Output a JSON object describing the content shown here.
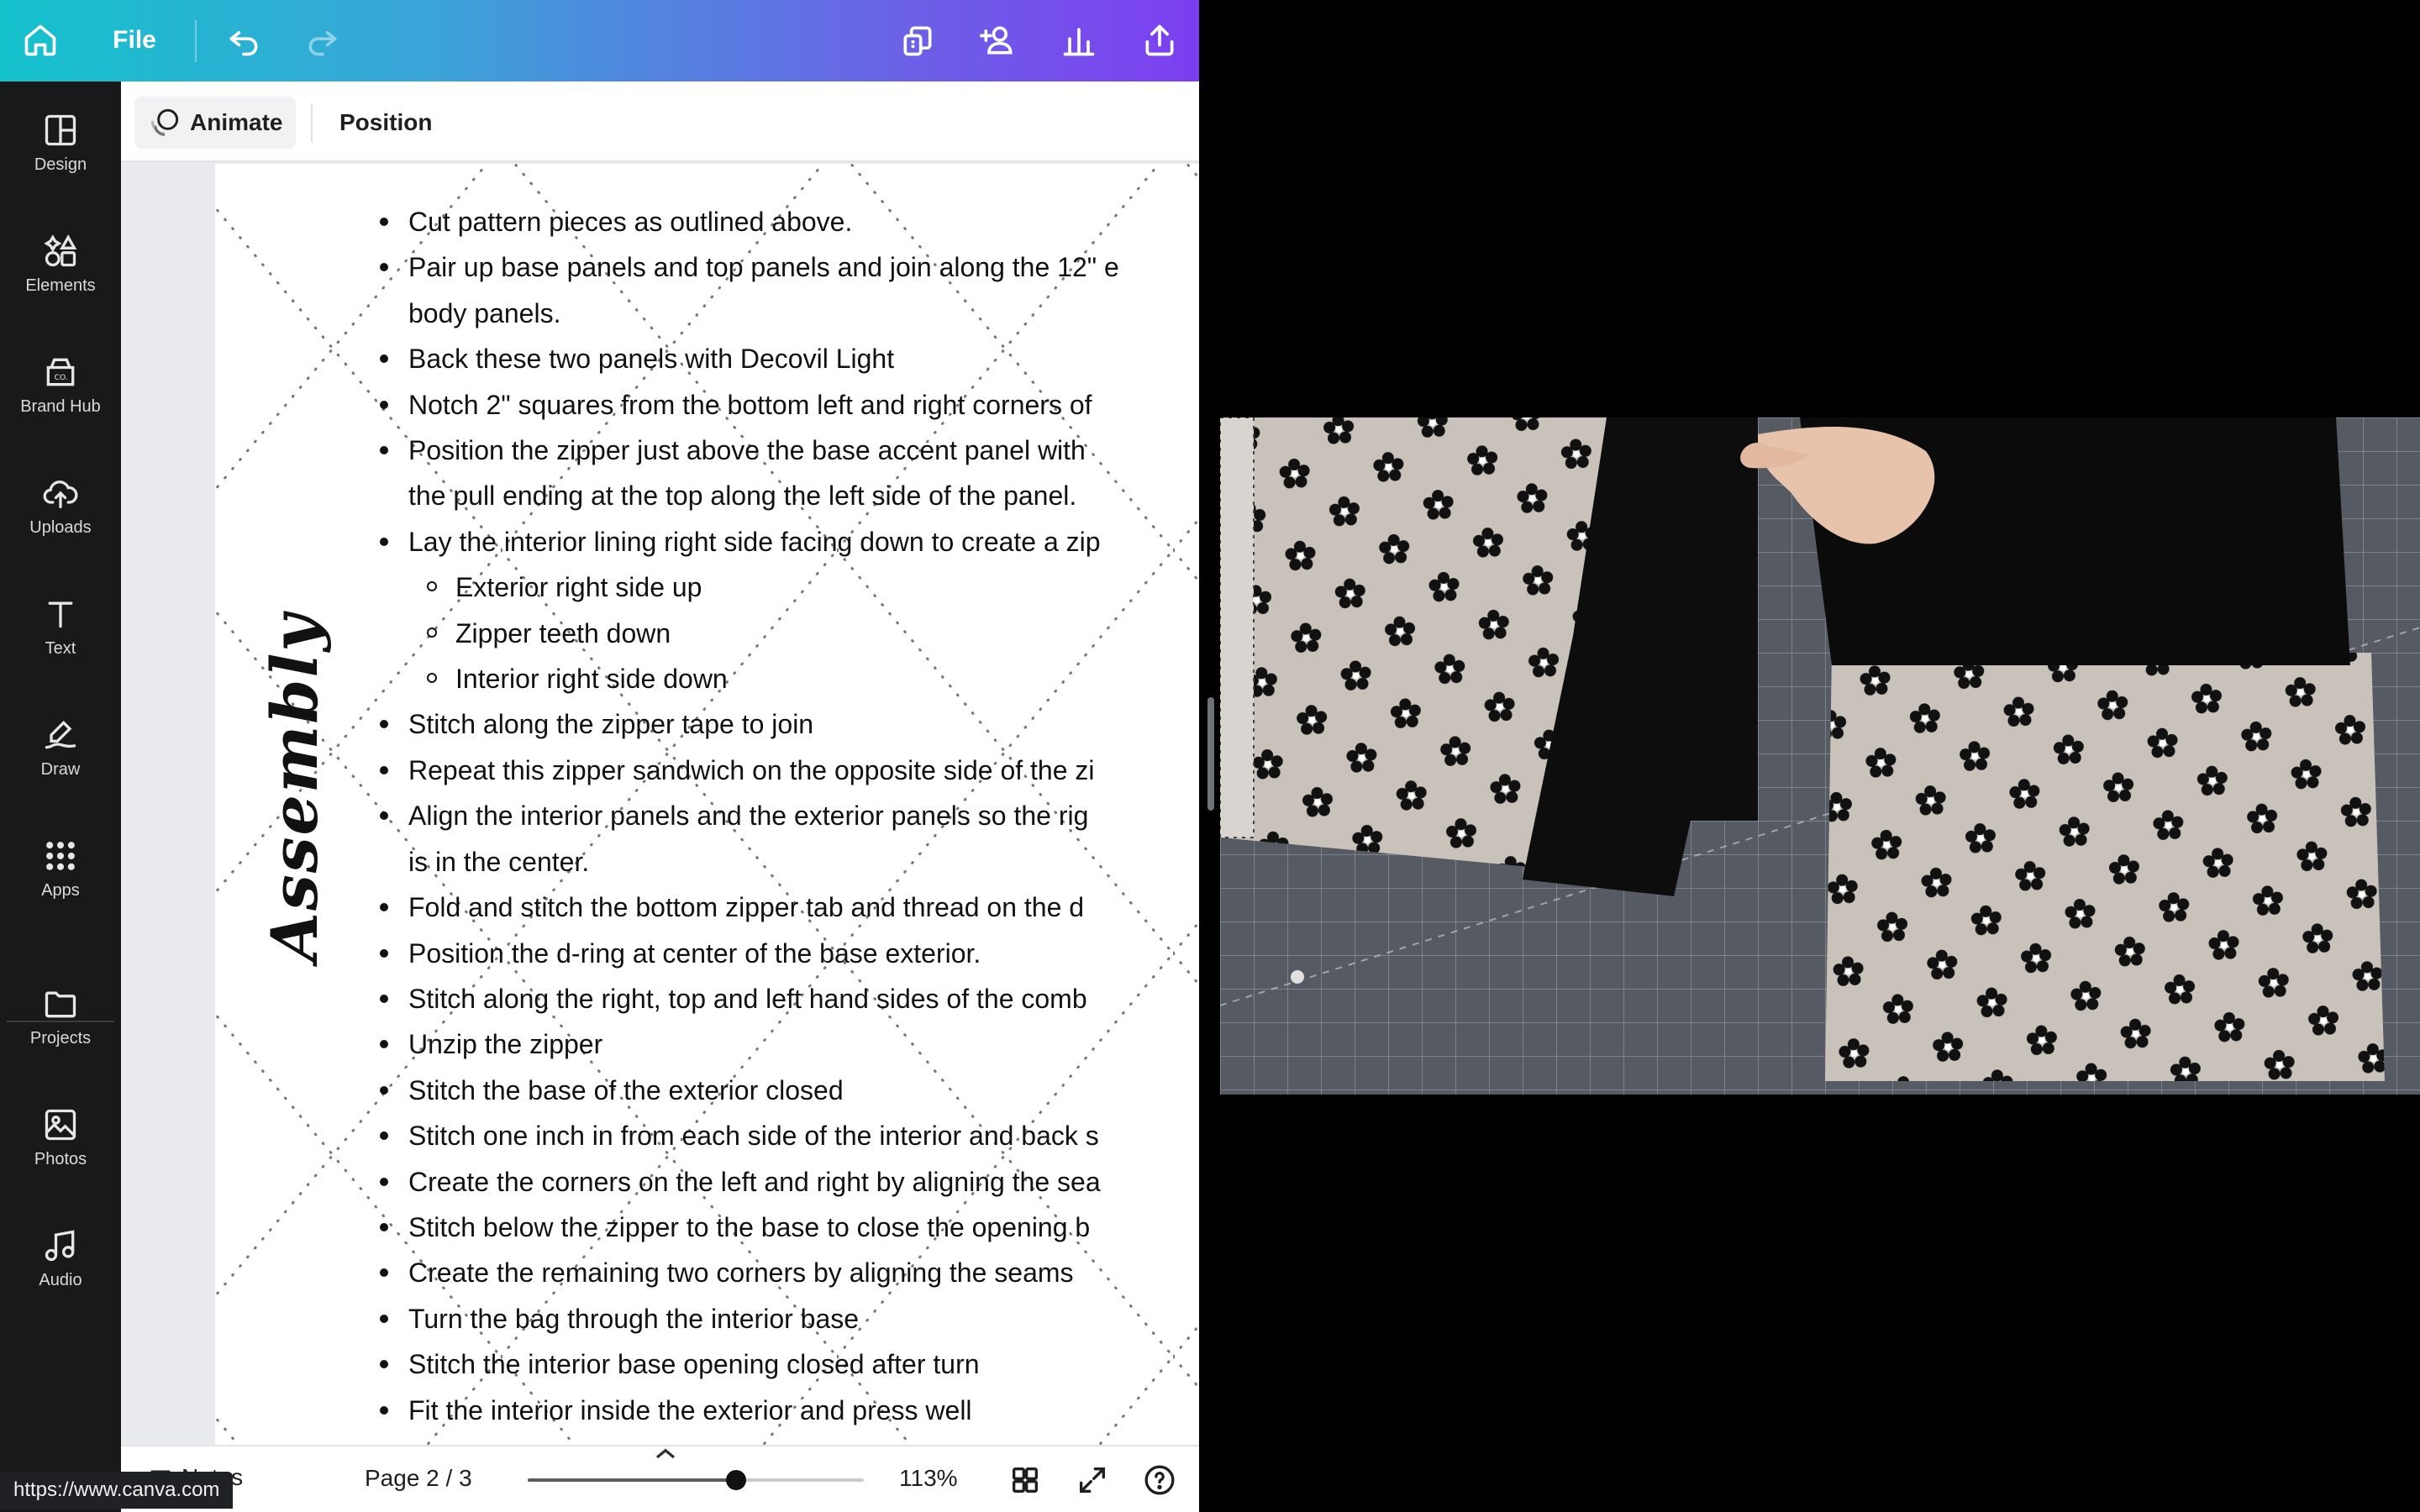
{
  "topbar": {
    "file_label": "File",
    "icons": [
      "home-icon",
      "undo-icon",
      "redo-icon",
      "resize-icon",
      "share-people-icon",
      "insights-icon",
      "upload-share-icon"
    ]
  },
  "sidebar": {
    "items": [
      {
        "label": "Design",
        "icon": "design-icon"
      },
      {
        "label": "Elements",
        "icon": "elements-icon"
      },
      {
        "label": "Brand Hub",
        "icon": "brand-hub-icon"
      },
      {
        "label": "Uploads",
        "icon": "uploads-icon"
      },
      {
        "label": "Text",
        "icon": "text-icon"
      },
      {
        "label": "Draw",
        "icon": "draw-icon"
      },
      {
        "label": "Apps",
        "icon": "apps-icon"
      },
      {
        "label": "Projects",
        "icon": "projects-icon"
      },
      {
        "label": "Photos",
        "icon": "photos-icon"
      },
      {
        "label": "Audio",
        "icon": "audio-icon"
      }
    ]
  },
  "context_toolbar": {
    "animate_label": "Animate",
    "position_label": "Position"
  },
  "document": {
    "section_title": "Assembly",
    "list": [
      {
        "level": 1,
        "text": "Cut pattern pieces as outlined above."
      },
      {
        "level": 1,
        "text": "Pair up base panels and top panels and join along the 12\" e"
      },
      {
        "level": 0,
        "text": "body panels."
      },
      {
        "level": 1,
        "text": "Back these two panels with Decovil Light"
      },
      {
        "level": 1,
        "text": "Notch 2\" squares from the bottom left and right corners of"
      },
      {
        "level": 1,
        "text": "Position the zipper just above the base accent panel with"
      },
      {
        "level": 0,
        "text": "the pull ending at the top along the left side of the panel."
      },
      {
        "level": 1,
        "text": "Lay the interior lining right side facing down to create a zip"
      },
      {
        "level": 2,
        "text": "Exterior right side up"
      },
      {
        "level": 2,
        "text": "Zipper teeth down"
      },
      {
        "level": 2,
        "text": "Interior right side down"
      },
      {
        "level": 1,
        "text": "Stitch along the zipper tape to join"
      },
      {
        "level": 1,
        "text": "Repeat this zipper sandwich on the opposite side of the zi"
      },
      {
        "level": 1,
        "text": " Align the interior panels and the exterior panels so the rig"
      },
      {
        "level": 0,
        "text": "is in the center."
      },
      {
        "level": 1,
        "text": "Fold and stitch the bottom zipper tab and thread on the d"
      },
      {
        "level": 1,
        "text": "Position the d-ring at center of the base exterior."
      },
      {
        "level": 1,
        "text": "Stitch along the right, top and left hand sides of the comb"
      },
      {
        "level": 1,
        "text": "Unzip the zipper"
      },
      {
        "level": 1,
        "text": "Stitch the base of the exterior closed"
      },
      {
        "level": 1,
        "text": "Stitch one inch in from each side of the interior and back s"
      },
      {
        "level": 1,
        "text": "Create the corners on the left and right by aligning the sea"
      },
      {
        "level": 1,
        "text": "Stitch below the zipper to the base to close the opening b"
      },
      {
        "level": 1,
        "text": "Create the remaining two corners by aligning the seams"
      },
      {
        "level": 1,
        "text": "Turn the bag through the interior base"
      },
      {
        "level": 1,
        "text": "Stitch the interior base opening closed after turn"
      },
      {
        "level": 1,
        "text": "Fit the interior inside the exterior and press well"
      }
    ]
  },
  "bottom_bar": {
    "notes_label": "Notes",
    "page_indicator": "Page 2 / 3",
    "zoom_label": "113%",
    "zoom_level": 0.62
  },
  "status_url": "https://www.canva.com",
  "colors": {
    "topbar_start": "#14c2cc",
    "topbar_end": "#7d3ef0",
    "sidebar_bg": "#18191b",
    "fabric_bg": "#c9c2bb",
    "mat_bg": "#565b63"
  }
}
